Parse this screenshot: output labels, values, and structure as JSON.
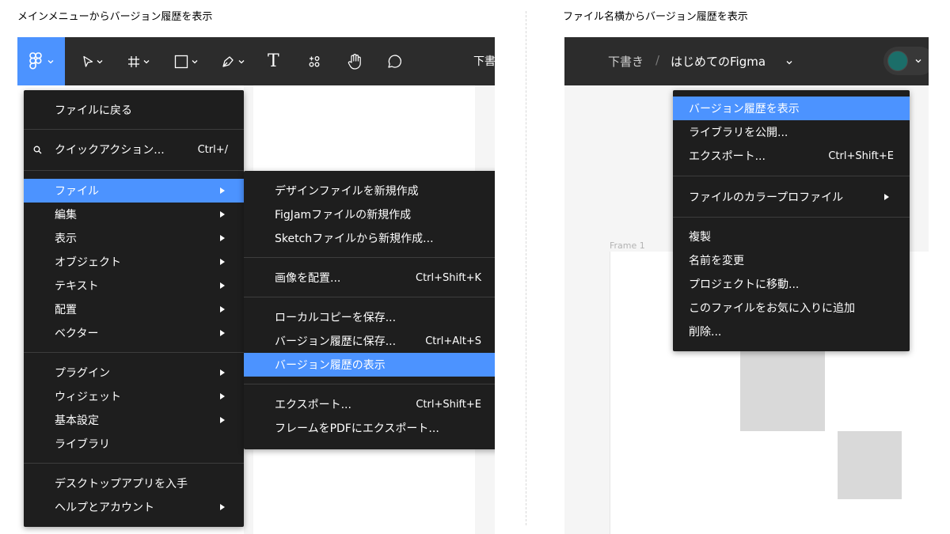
{
  "captions": {
    "left": "メインメニューからバージョン履歴を表示",
    "right": "ファイル名横からバージョン履歴を表示"
  },
  "colors": {
    "toolbar": "#2c2c2c",
    "menu": "#1e1e1e",
    "highlight": "#4c93ff",
    "avatar": "#1b6e69"
  },
  "toolbar": {
    "icons": [
      "figma-logo-icon",
      "move-tool-icon",
      "frame-tool-icon",
      "shape-tool-icon",
      "pen-tool-icon",
      "text-tool-icon",
      "resources-icon",
      "hand-tool-icon",
      "comment-icon"
    ],
    "text_tool": "T",
    "draft_cut": "下書"
  },
  "main_menu": {
    "back": "ファイルに戻る",
    "quick_actions": {
      "label": "クイックアクション...",
      "shortcut": "Ctrl+/"
    },
    "items": [
      {
        "label": "ファイル",
        "submenu": true,
        "highlighted": true
      },
      {
        "label": "編集",
        "submenu": true
      },
      {
        "label": "表示",
        "submenu": true
      },
      {
        "label": "オブジェクト",
        "submenu": true
      },
      {
        "label": "テキスト",
        "submenu": true
      },
      {
        "label": "配置",
        "submenu": true
      },
      {
        "label": "ベクター",
        "submenu": true
      }
    ],
    "items2": [
      {
        "label": "プラグイン",
        "submenu": true
      },
      {
        "label": "ウィジェット",
        "submenu": true
      },
      {
        "label": "基本設定",
        "submenu": true
      },
      {
        "label": "ライブラリ",
        "submenu": false
      }
    ],
    "items3": [
      {
        "label": "デスクトップアプリを入手",
        "submenu": false
      },
      {
        "label": "ヘルプとアカウント",
        "submenu": true
      }
    ]
  },
  "file_submenu": {
    "group1": [
      {
        "label": "デザインファイルを新規作成"
      },
      {
        "label": "FigJamファイルの新規作成"
      },
      {
        "label": "Sketchファイルから新規作成..."
      }
    ],
    "group2": [
      {
        "label": "画像を配置...",
        "shortcut": "Ctrl+Shift+K"
      }
    ],
    "group3": [
      {
        "label": "ローカルコピーを保存..."
      },
      {
        "label": "バージョン履歴に保存...",
        "shortcut": "Ctrl+Alt+S"
      },
      {
        "label": "バージョン履歴の表示",
        "highlighted": true
      }
    ],
    "group4": [
      {
        "label": "エクスポート...",
        "shortcut": "Ctrl+Shift+E"
      },
      {
        "label": "フレームをPDFにエクスポート..."
      }
    ]
  },
  "right_bar": {
    "project": "下書き",
    "separator": "/",
    "file_name": "はじめてのFigma"
  },
  "file_menu": {
    "group1": [
      {
        "label": "バージョン履歴を表示",
        "highlighted": true
      },
      {
        "label": "ライブラリを公開..."
      },
      {
        "label": "エクスポート...",
        "shortcut": "Ctrl+Shift+E"
      }
    ],
    "group2": [
      {
        "label": "ファイルのカラープロファイル",
        "submenu": true
      }
    ],
    "group3": [
      {
        "label": "複製"
      },
      {
        "label": "名前を変更"
      },
      {
        "label": "プロジェクトに移動..."
      },
      {
        "label": "このファイルをお気に入りに追加"
      },
      {
        "label": "削除..."
      }
    ]
  },
  "canvas": {
    "frame_label": "Frame 1"
  }
}
